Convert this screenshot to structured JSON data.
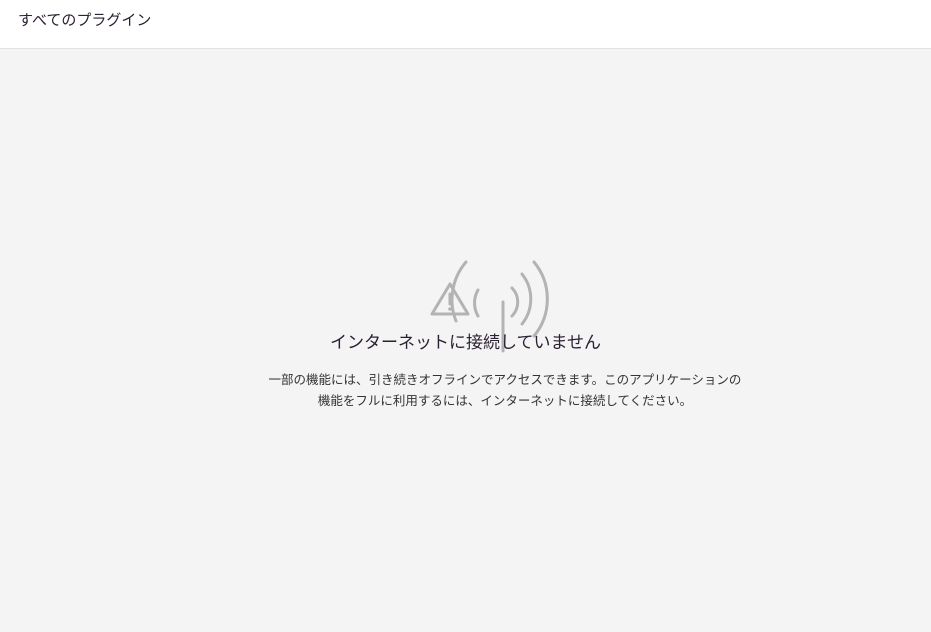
{
  "header": {
    "title": "すべてのプラグイン"
  },
  "offline": {
    "icon": "offline-signal-warning-icon",
    "heading": "インターネットに接続していません",
    "message_line1": "一部の機能には、引き続きオフラインでアクセスできます。このアプリケーションの",
    "message_line2": "機能をフルに利用するには、インターネットに接続してください。"
  },
  "colors": {
    "background": "#f4f4f4",
    "header_background": "#ffffff",
    "icon_gray": "#b3b3b3",
    "heading_text": "#2c2033"
  }
}
